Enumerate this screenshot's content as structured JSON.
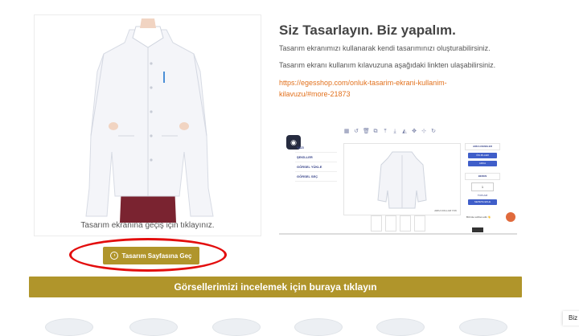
{
  "product": {
    "caption": "Tasarım ekranına geçiş için tıklayınız.",
    "button_label": "Tasarım Sayfasına Geç",
    "button_icon": "arrow-right-circle-icon"
  },
  "info": {
    "title": "Siz Tasarlayın. Biz yapalım.",
    "paragraph1": "Tasarım ekranımızı kullanarak kendi tasarımınızı oluşturabilirsiniz.",
    "paragraph2": "Tasarım ekranı kullanım kılavuzuna aşağıdaki linkten ulaşabilirsiniz.",
    "link_text": "https://egesshop.com/onluk-tasarim-ekrani-kullanim-kilavuzu/#more-21873"
  },
  "editor_preview": {
    "left_menu": [
      "YAZI",
      "ŞEKİLLER",
      "GÖRSEL YÜKLE",
      "GÖRSEL SEÇ"
    ],
    "right_header": "ARKA RENKLER",
    "right_buttons": [
      "ÖN ZİLLER",
      "ARKA"
    ],
    "size_label": "BEDEN",
    "quantity": "1",
    "total_label": "TOPLAM",
    "cart_button": "SEPETE EKLE",
    "canvas_note": "ARKA KOLLAR YOK",
    "help_text": "Bizimle sohbet edin 👋",
    "accent_color": "#3f5ec9"
  },
  "banner": {
    "label": "Görsellerimizi incelemek için buraya tıklayın"
  },
  "side_tab": {
    "label": "Biz"
  },
  "colors": {
    "gold": "#b0952b",
    "highlight_red": "#e30d0d",
    "link_orange": "#e2711d"
  }
}
